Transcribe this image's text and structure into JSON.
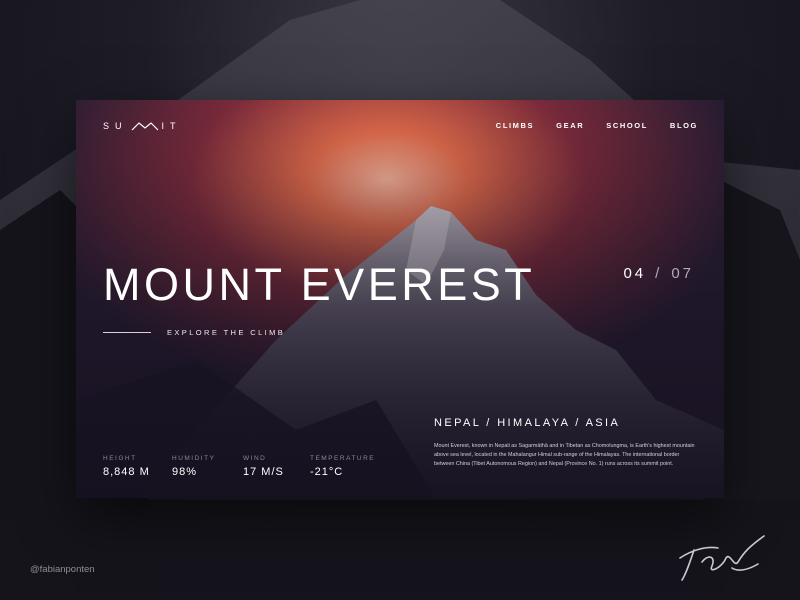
{
  "logo": {
    "text_left": "SU",
    "text_right": "IT",
    "mark_icon": "mountain-m-icon"
  },
  "nav": {
    "items": [
      {
        "label": "CLIMBS"
      },
      {
        "label": "GEAR"
      },
      {
        "label": "SCHOOL"
      },
      {
        "label": "BLOG"
      }
    ]
  },
  "hero": {
    "title": "MOUNT EVEREST",
    "explore_label": "EXPLORE THE CLIMB",
    "counter": {
      "current": "04",
      "separator": "/",
      "total": "07"
    }
  },
  "stats": [
    {
      "label": "HEIGHT",
      "value": "8,848 M"
    },
    {
      "label": "HUMIDITY",
      "value": "98%"
    },
    {
      "label": "WIND",
      "value": "17 M/S"
    },
    {
      "label": "TEMPERATURE",
      "value": "-21°C"
    }
  ],
  "location": {
    "title": "NEPAL / HIMALAYA / ASIA",
    "description": "Mount Everest, known in Nepali as Sagarmāthā and in Tibetan as Chomolungma, is Earth's highest mountain above sea level, located in the Mahalangur Himal sub-range of the Himalayas. The international border between China (Tibet Autonomous Region) and Nepal (Province No. 1) runs across its summit point."
  },
  "footer": {
    "credit": "@fabianponten"
  },
  "colors": {
    "glow": "#e06a4a",
    "card_dark": "#241c31",
    "page_bg": "#14131d"
  }
}
